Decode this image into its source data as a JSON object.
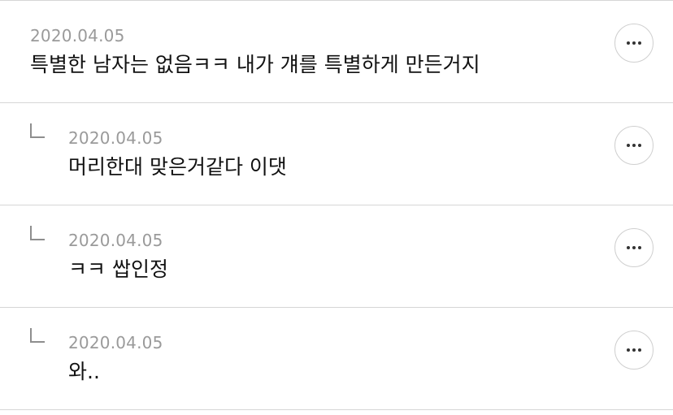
{
  "comments": [
    {
      "date": "2020.04.05",
      "text": "특별한 남자는 없음ㅋㅋ 내가 걔를 특별하게 만든거지",
      "is_reply": false,
      "more_icon": "more-horizontal-icon"
    },
    {
      "date": "2020.04.05",
      "text": "머리한대 맞은거같다 이댓",
      "is_reply": true,
      "more_icon": "more-horizontal-icon"
    },
    {
      "date": "2020.04.05",
      "text": "ㅋㅋ 쌉인정",
      "is_reply": true,
      "more_icon": "more-horizontal-icon"
    },
    {
      "date": "2020.04.05",
      "text": "와..",
      "is_reply": true,
      "more_icon": "more-horizontal-icon"
    }
  ],
  "colors": {
    "divider": "#d6d6d6",
    "date": "#9a9a9a",
    "text": "#111111",
    "button_border": "#cfcfcf",
    "reply_mark": "#8e8e8e"
  }
}
